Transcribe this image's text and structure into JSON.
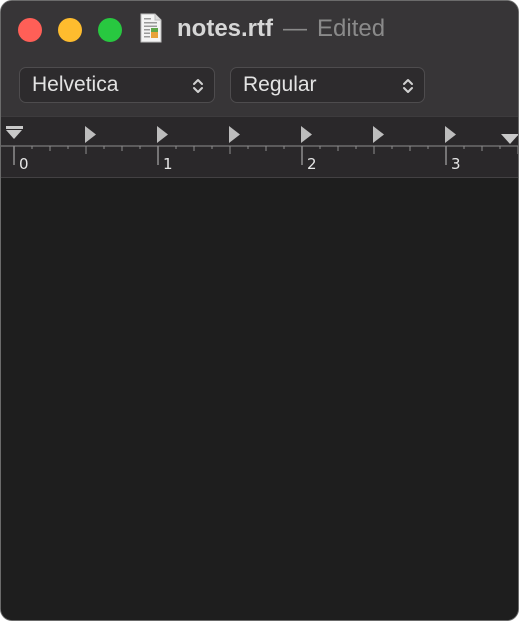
{
  "window": {
    "title": "notes.rtf",
    "separator": "—",
    "status": "Edited",
    "buttons": {
      "close_color": "#ff5f57",
      "minimize_color": "#febc2e",
      "zoom_color": "#28c840"
    }
  },
  "toolbar": {
    "font_family": "Helvetica",
    "font_style": "Regular"
  },
  "ruler": {
    "numbers": [
      "0",
      "1",
      "2",
      "3"
    ],
    "units": "inches"
  },
  "document": {
    "text": ""
  }
}
